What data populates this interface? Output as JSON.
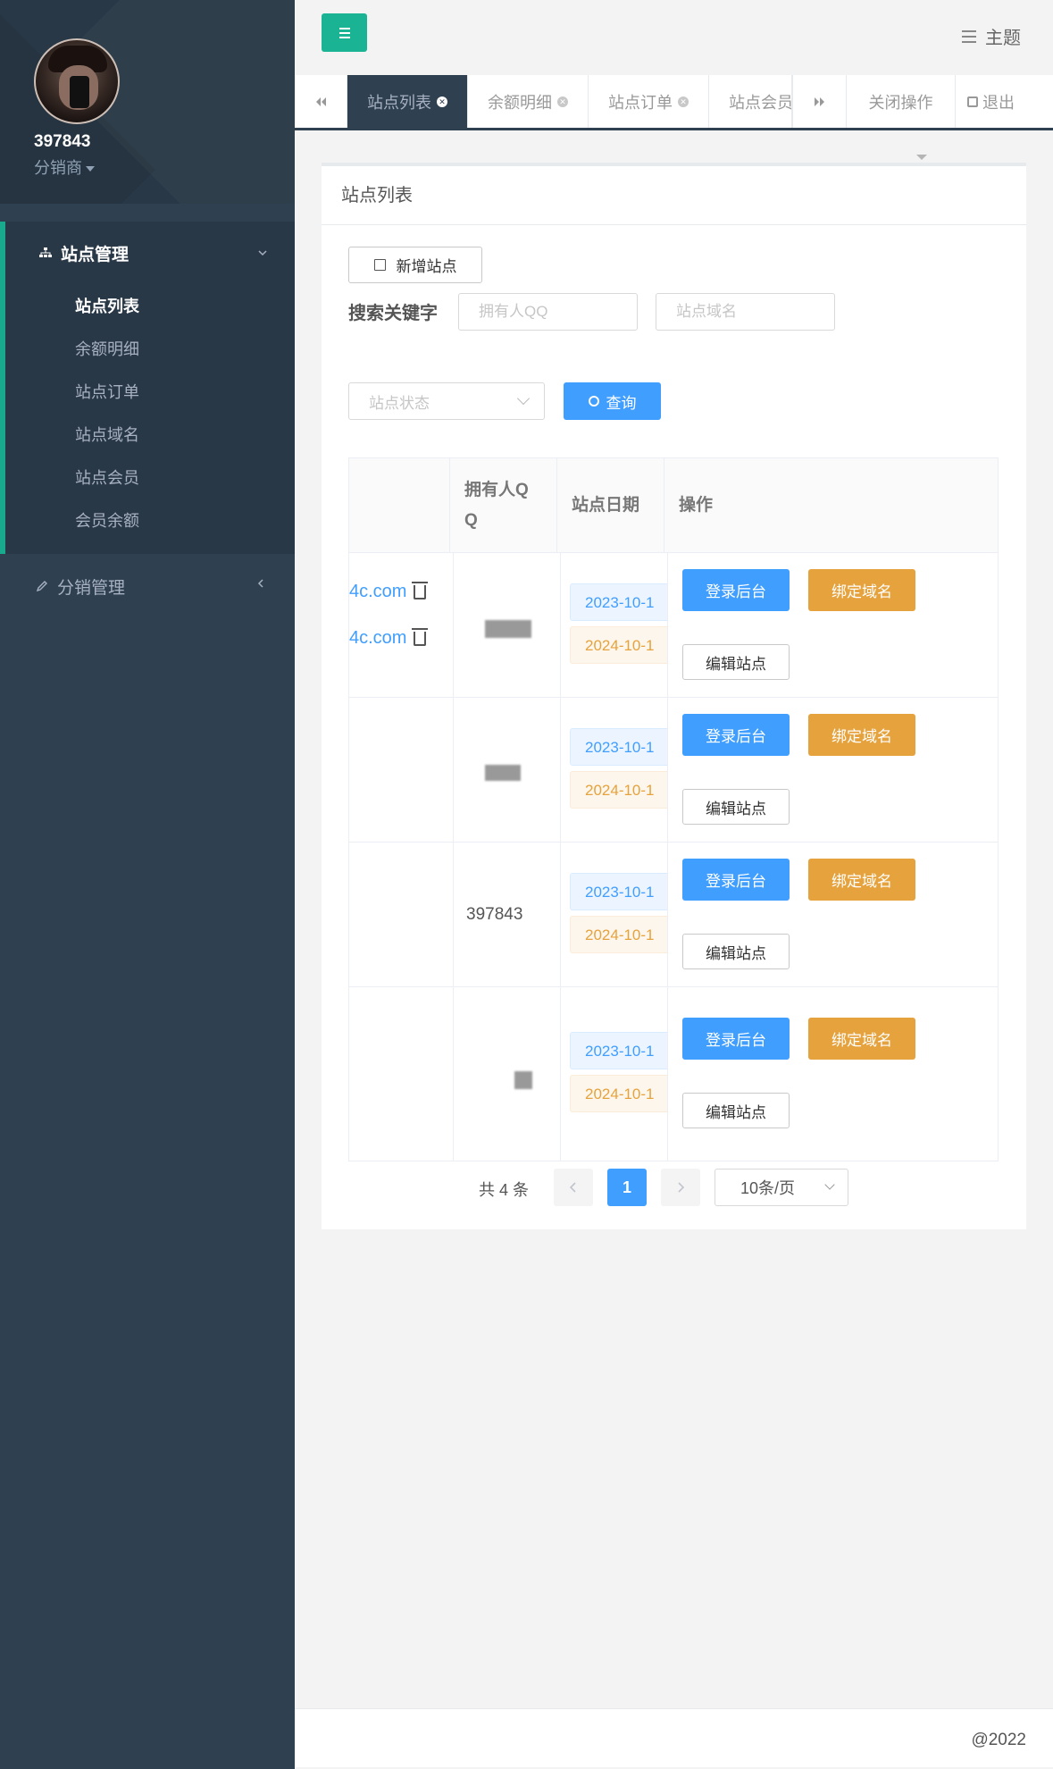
{
  "user": {
    "name": "397843",
    "role": "分销商"
  },
  "sidebar": {
    "groups": [
      {
        "label": "站点管理",
        "items": [
          "站点列表",
          "余额明细",
          "站点订单",
          "站点域名",
          "站点会员",
          "会员余额"
        ]
      },
      {
        "label": "分销管理"
      }
    ]
  },
  "topbar": {
    "theme_label": "主题"
  },
  "tabs": {
    "items": [
      "站点列表",
      "余额明细",
      "站点订单",
      "站点会员"
    ],
    "close_ops": "关闭操作",
    "logout": "退出"
  },
  "panel": {
    "title": "站点列表",
    "add_button": "新增站点",
    "search_label": "搜索关键字",
    "qq_placeholder": "拥有人QQ",
    "domain_placeholder": "站点域名",
    "status_placeholder": "站点状态",
    "query_button": "查询"
  },
  "table": {
    "headers": [
      "拥有人Q Q",
      "站点日期",
      "操作"
    ],
    "rows": [
      {
        "domains": [
          "4c.com",
          "4c.com"
        ],
        "owner": "",
        "date_start": "2023-10-1",
        "date_end": "2024-10-1"
      },
      {
        "domains": [],
        "owner": "",
        "date_start": "2023-10-1",
        "date_end": "2024-10-1"
      },
      {
        "domains": [],
        "owner": "397843",
        "date_start": "2023-10-1",
        "date_end": "2024-10-1"
      },
      {
        "domains": [],
        "owner": "",
        "date_start": "2023-10-1",
        "date_end": "2024-10-1"
      }
    ],
    "actions": {
      "login": "登录后台",
      "bind": "绑定域名",
      "edit": "编辑站点"
    }
  },
  "pagination": {
    "total": "共 4 条",
    "current": "1",
    "page_size": "10条/页"
  },
  "footer": {
    "text": "@2022"
  },
  "colors": {
    "sidebar": "#2f4050",
    "accent": "#1ab394",
    "primary": "#409eff",
    "warning": "#e6a23c"
  }
}
